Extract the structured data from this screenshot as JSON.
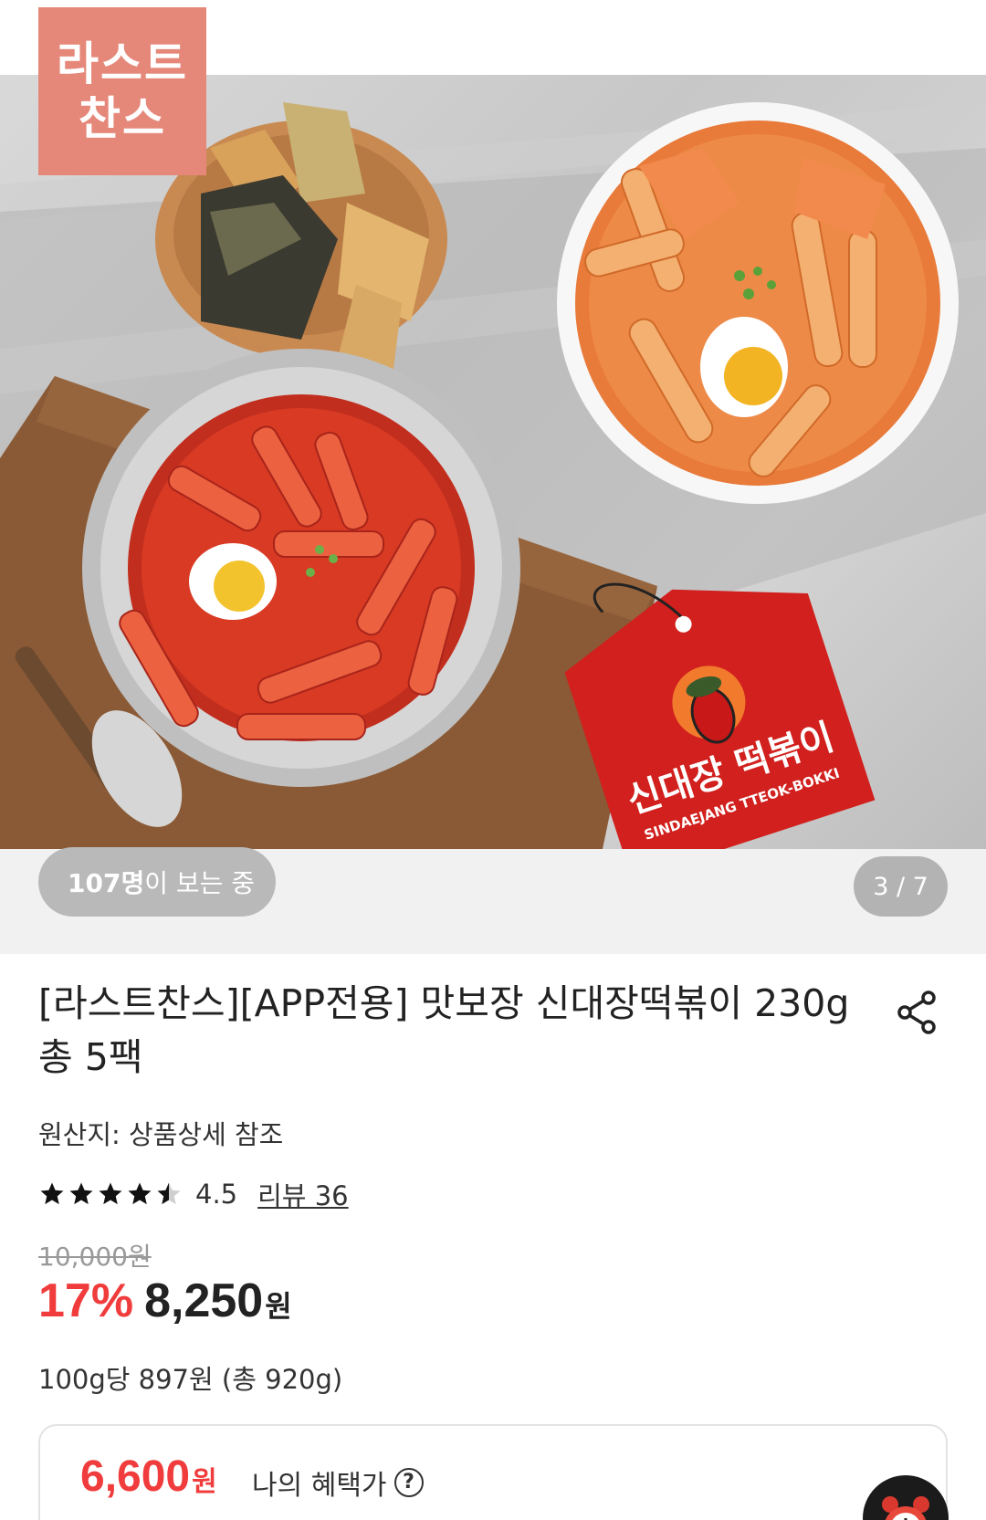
{
  "hero": {
    "badge_line1": "라스트",
    "badge_line2": "찬스",
    "package_tag_line1": "신대장 떡볶이",
    "package_tag_line2": "SINDAEJANG TTEOK-BOKKI",
    "viewers_count": "107명",
    "viewers_suffix": "이 보는 중",
    "image_counter": "3 / 7"
  },
  "product": {
    "title_line1": "[라스트찬스][APP전용] 맛보장 신대장떡볶이 230g",
    "title_line2": "총 5팩",
    "origin": "원산지: 상품상세 참조",
    "rating_value": "4.5",
    "rating_stars": 4.5,
    "review_link": "리뷰 36",
    "original_price": "10,000원",
    "discount": "17%",
    "sale_price": "8,250",
    "currency": "원",
    "unit_price": "100g당 897원 (총 920g)"
  },
  "benefit": {
    "price": "6,600",
    "currency": "원",
    "label": "나의 혜택가",
    "help_symbol": "?"
  },
  "colors": {
    "accent_red": "#f03c3c",
    "badge_bg": "#e58879"
  },
  "icons": [
    "share-icon",
    "star-icon",
    "help-icon",
    "alarm-clock-icon"
  ]
}
